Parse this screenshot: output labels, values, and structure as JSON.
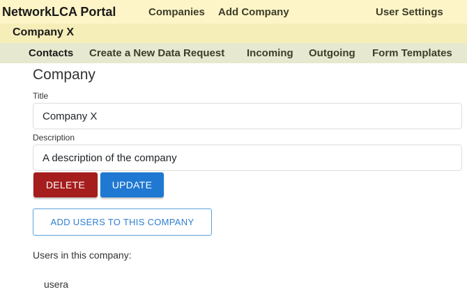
{
  "header": {
    "brand": "NetworkLCA Portal",
    "nav": {
      "companies": "Companies",
      "add_company": "Add Company",
      "user_settings": "User Settings"
    }
  },
  "company_bar": {
    "name": "Company X"
  },
  "subnav": {
    "contacts": "Contacts",
    "create_request": "Create a New Data Request",
    "incoming": "Incoming",
    "outgoing": "Outgoing",
    "form_templates": "Form Templates"
  },
  "form": {
    "section_title": "Company",
    "title_label": "Title",
    "title_value": "Company X",
    "description_label": "Description",
    "description_value": "A description of the company",
    "delete_label": "DELETE",
    "update_label": "UPDATE",
    "add_users_label": "ADD USERS TO THIS COMPANY"
  },
  "users": {
    "heading": "Users in this company:",
    "items": [
      "usera"
    ]
  },
  "colors": {
    "topbar": "#fdf5c7",
    "company_bar": "#f5eeb8",
    "subnav": "#e6e9cf",
    "delete": "#a51d1d",
    "update": "#1f78d1",
    "outline_accent": "#2f7fcf"
  }
}
